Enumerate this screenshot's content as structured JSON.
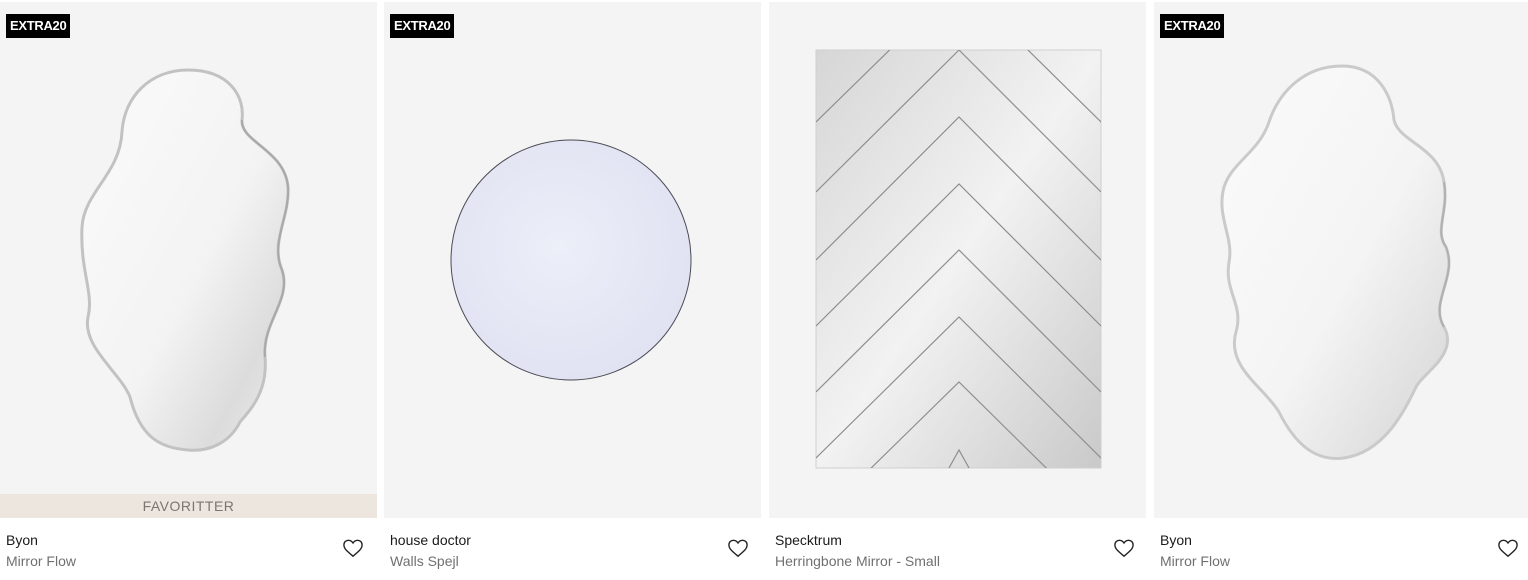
{
  "products": [
    {
      "badge": "EXTRA20",
      "banner": "FAVORITTER",
      "brand": "Byon",
      "name": "Mirror Flow",
      "image_icon": "wavy-mirror-image"
    },
    {
      "badge": "EXTRA20",
      "brand": "house doctor",
      "name": "Walls Spejl",
      "image_icon": "round-mirror-image"
    },
    {
      "brand": "Specktrum",
      "name": "Herringbone Mirror - Small",
      "image_icon": "herringbone-mirror-image"
    },
    {
      "badge": "EXTRA20",
      "brand": "Byon",
      "name": "Mirror Flow",
      "image_icon": "wavy-mirror-image"
    }
  ],
  "icons": {
    "favorite": "heart-outline-icon"
  },
  "colors": {
    "badge_bg": "#000000",
    "banner_bg": "#ece6df",
    "image_bg": "#f4f4f4"
  }
}
